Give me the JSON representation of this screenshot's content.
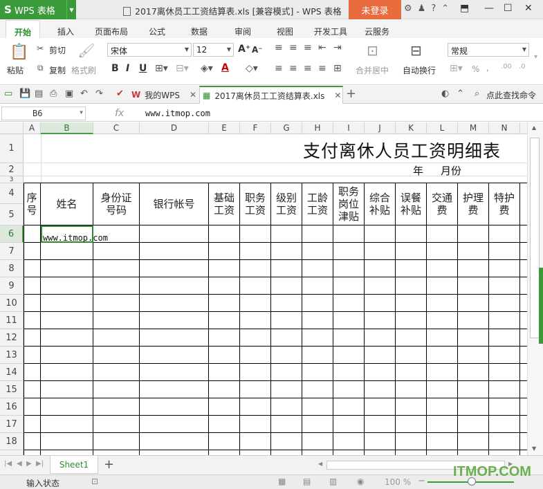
{
  "app": {
    "logo_s": "S",
    "logo_text": "WPS 表格",
    "window_title": "2017离休员工工资结算表.xls [兼容模式] - WPS 表格",
    "login_label": "未登录"
  },
  "tabs": [
    "开始",
    "插入",
    "页面布局",
    "公式",
    "数据",
    "审阅",
    "视图",
    "开发工具",
    "云服务"
  ],
  "ribbon": {
    "paste": "粘贴",
    "cut": "剪切",
    "copy": "复制",
    "format_painter": "格式刷",
    "font_name": "宋体",
    "font_size": "12",
    "merge_center": "合并居中",
    "wrap_text": "自动换行",
    "number_format": "常规",
    "percent": "%",
    "thousands": ","
  },
  "doc_tabs": {
    "home": "我的WPS",
    "file": "2017离休员工工资结算表.xls",
    "search": "点此查找命令"
  },
  "formula_bar": {
    "name_box": "B6",
    "fx": "fx",
    "value": "www.itmop.com"
  },
  "columns": [
    "A",
    "B",
    "C",
    "D",
    "E",
    "F",
    "G",
    "H",
    "I",
    "J",
    "K",
    "L",
    "M",
    "N"
  ],
  "rows": [
    "1",
    "2",
    "3",
    "4",
    "5",
    "6",
    "7",
    "8",
    "9",
    "10",
    "11",
    "12",
    "13",
    "14",
    "15",
    "16",
    "17",
    "18"
  ],
  "sheet": {
    "title": "支付离休人员工资明细表",
    "year": "年",
    "month": "月份",
    "headers": [
      "序\n号",
      "姓名",
      "身份证\n号码",
      "银行帐号",
      "基础\n工资",
      "职务\n工资",
      "级别\n工资",
      "工龄\n工资",
      "职务\n岗位\n津贴",
      "综合\n补贴",
      "误餐\n补贴",
      "交通\n费",
      "护理\n费",
      "特护\n费"
    ],
    "b6_value": "www.itmop.com"
  },
  "sheet_tab": "Sheet1",
  "status": {
    "mode": "输入状态",
    "zoom": "100 %"
  },
  "watermark": "ITMOP.COM",
  "colors": {
    "brand_green": "#3a9a3a",
    "login_orange": "#e96c3f"
  }
}
